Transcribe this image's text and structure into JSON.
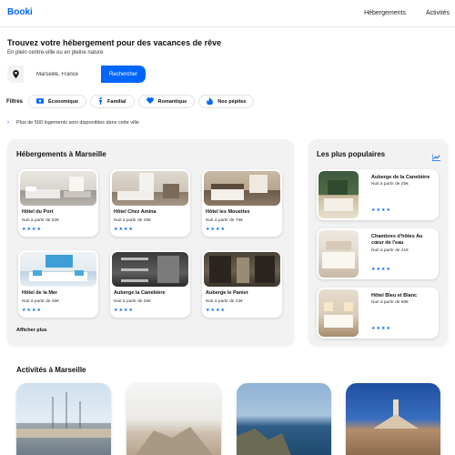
{
  "header": {
    "logo": "Booki",
    "nav": [
      "Hébergements",
      "Activités"
    ]
  },
  "hero": {
    "title": "Trouvez votre hébergement pour des vacances de rêve",
    "subtitle": "En plein centre-ville ou en pleine nature"
  },
  "search": {
    "value": "Marseille, France",
    "button": "Rechercher",
    "icon": "map-pin-icon"
  },
  "filters": {
    "label": "Filtres",
    "chips": [
      {
        "label": "Économique",
        "icon": "money-icon"
      },
      {
        "label": "Familial",
        "icon": "child-icon"
      },
      {
        "label": "Romantique",
        "icon": "heart-icon"
      },
      {
        "label": "Nos pépites",
        "icon": "gem-icon"
      }
    ]
  },
  "info": {
    "text": "Plus de 500 logements sont disponibles dans cette ville",
    "icon": "info-icon"
  },
  "accommodations": {
    "title": "Hébergements à Marseille",
    "more": "Afficher plus",
    "cards": [
      {
        "name": "Hôtel du Port",
        "price": "Nuit à partir de 52€",
        "rating": 4
      },
      {
        "name": "Hôtel Chez Amina",
        "price": "Nuit à partir de 25€",
        "rating": 4
      },
      {
        "name": "Hôtel les Mouettes",
        "price": "Nuit à partir de 76€",
        "rating": 4
      },
      {
        "name": "Hôtel de la Mer",
        "price": "Nuit à partir de 46€",
        "rating": 4
      },
      {
        "name": "Auberge la Canebière",
        "price": "Nuit à partir de 25€",
        "rating": 4
      },
      {
        "name": "Auberge le Panier",
        "price": "Nuit à partir de 23€",
        "rating": 4
      }
    ]
  },
  "popular": {
    "title": "Les plus populaires",
    "icon": "trend-chart-icon",
    "items": [
      {
        "name": "Auberge de la Canebière",
        "price": "Nuit à partir de 25€",
        "rating": 4
      },
      {
        "name": "Chambres d'hôtes Au cœur de l'eau",
        "price": "Nuit à partir de 41€",
        "rating": 4
      },
      {
        "name": "Hôtel Bleu et Blanc",
        "price": "Nuit à partir de 68€",
        "rating": 4
      }
    ]
  },
  "activities": {
    "title": "Activités à Marseille"
  },
  "colors": {
    "accent": "#0065fc",
    "panel": "#f2f2f2"
  }
}
